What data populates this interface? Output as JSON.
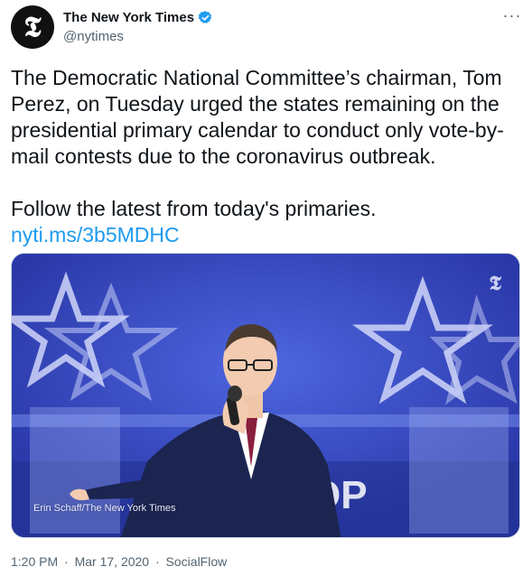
{
  "author": {
    "display_name": "The New York Times",
    "handle": "@nytimes",
    "avatar_glyph": "𝕿",
    "verified": true,
    "avatar_icon": "nyt-logo-icon"
  },
  "more_label": "···",
  "tweet": {
    "paragraph1": "The Democratic National Committee’s chairman, Tom Perez, on Tuesday urged the states remaining on the presidential primary calendar to conduct only vote-by-mail contests due to the coronavirus outbreak.",
    "paragraph2": "Follow the latest from today's primaries.",
    "link": "nyti.ms/3b5MDHC"
  },
  "media": {
    "credit": "Erin Schaff/The New York Times",
    "watermark": "𝕿",
    "watermark_icon": "nyt-watermark-icon"
  },
  "meta": {
    "time": "1:20 PM",
    "separator": "·",
    "date": "Mar 17, 2020",
    "source": "SocialFlow"
  },
  "colors": {
    "link": "#1d9bf0",
    "verified": "#1d9bf0",
    "muted": "#536471"
  }
}
